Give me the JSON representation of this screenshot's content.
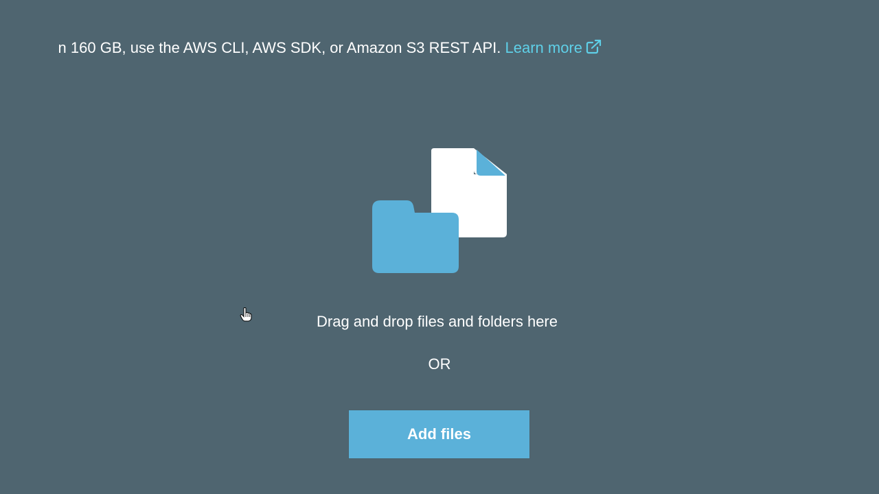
{
  "info": {
    "text": "n 160 GB, use the AWS CLI, AWS SDK, or Amazon S3 REST API.",
    "link_label": "Learn more",
    "link_icon": "external-link-icon"
  },
  "dropzone": {
    "illustration": "folder-and-file-icon",
    "instruction": "Drag and drop files and folders here",
    "separator": "OR",
    "button_label": "Add files"
  },
  "colors": {
    "background": "#4f6570",
    "accent": "#5bb1d9",
    "link": "#5fd0e8"
  },
  "cursor": {
    "icon": "hand-pointer-icon"
  }
}
